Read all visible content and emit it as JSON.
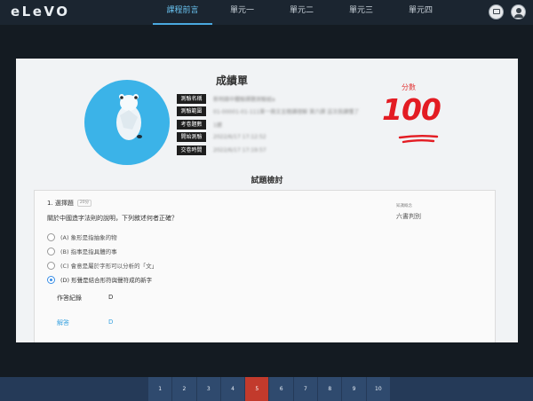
{
  "app": {
    "logo": "eLeVO"
  },
  "nav": {
    "items": [
      {
        "label": "課程前言",
        "active": true
      },
      {
        "label": "單元一",
        "active": false
      },
      {
        "label": "單元二",
        "active": false
      },
      {
        "label": "單元三",
        "active": false
      },
      {
        "label": "單元四",
        "active": false
      }
    ]
  },
  "header_icons": [
    "message-icon",
    "user-avatar-icon"
  ],
  "report": {
    "title": "成績單",
    "info": [
      {
        "label": "測驗名稱",
        "value": "新明國中體驗課題測驗組a"
      },
      {
        "label": "測驗範圍",
        "value": "01-00001-01-111第一冊文言閱讀理解 第六課 這次我讀懂了"
      },
      {
        "label": "考卷題數",
        "value": "1題"
      },
      {
        "label": "開始測驗",
        "value": "2022/6/17 17:12:52"
      },
      {
        "label": "交卷時間",
        "value": "2022/6/17 17:19:57"
      }
    ],
    "score_label": "分數",
    "score": "100"
  },
  "review": {
    "section_title": "試題檢討",
    "question": {
      "number": "1. 選擇題",
      "type_badge": "20分",
      "text": "關於中國造字法則的說明，下列敘述何者正確？",
      "side_label": "知識概念",
      "side_value": "六書判別",
      "options": [
        {
          "label": "(A) 象形是指抽象的物",
          "selected": false
        },
        {
          "label": "(B) 指事是指具體的事",
          "selected": false
        },
        {
          "label": "(C) 會意是屬於字形可以分析的「文」",
          "selected": false
        },
        {
          "label": "(D) 形聲是結合形符與聲符成的新字",
          "selected": true
        }
      ],
      "record_label": "作答紀錄",
      "record_value": "D",
      "answer_label": "解答",
      "answer_value": "D"
    }
  },
  "pager": {
    "pages": [
      "1",
      "2",
      "3",
      "4",
      "5",
      "6",
      "7",
      "8",
      "9",
      "10"
    ],
    "current": "5"
  },
  "colors": {
    "accent_blue": "#3aa3e0",
    "score_red": "#e31c23",
    "current_page": "#c23a2c",
    "avatar_bg": "#3bb3e8"
  }
}
